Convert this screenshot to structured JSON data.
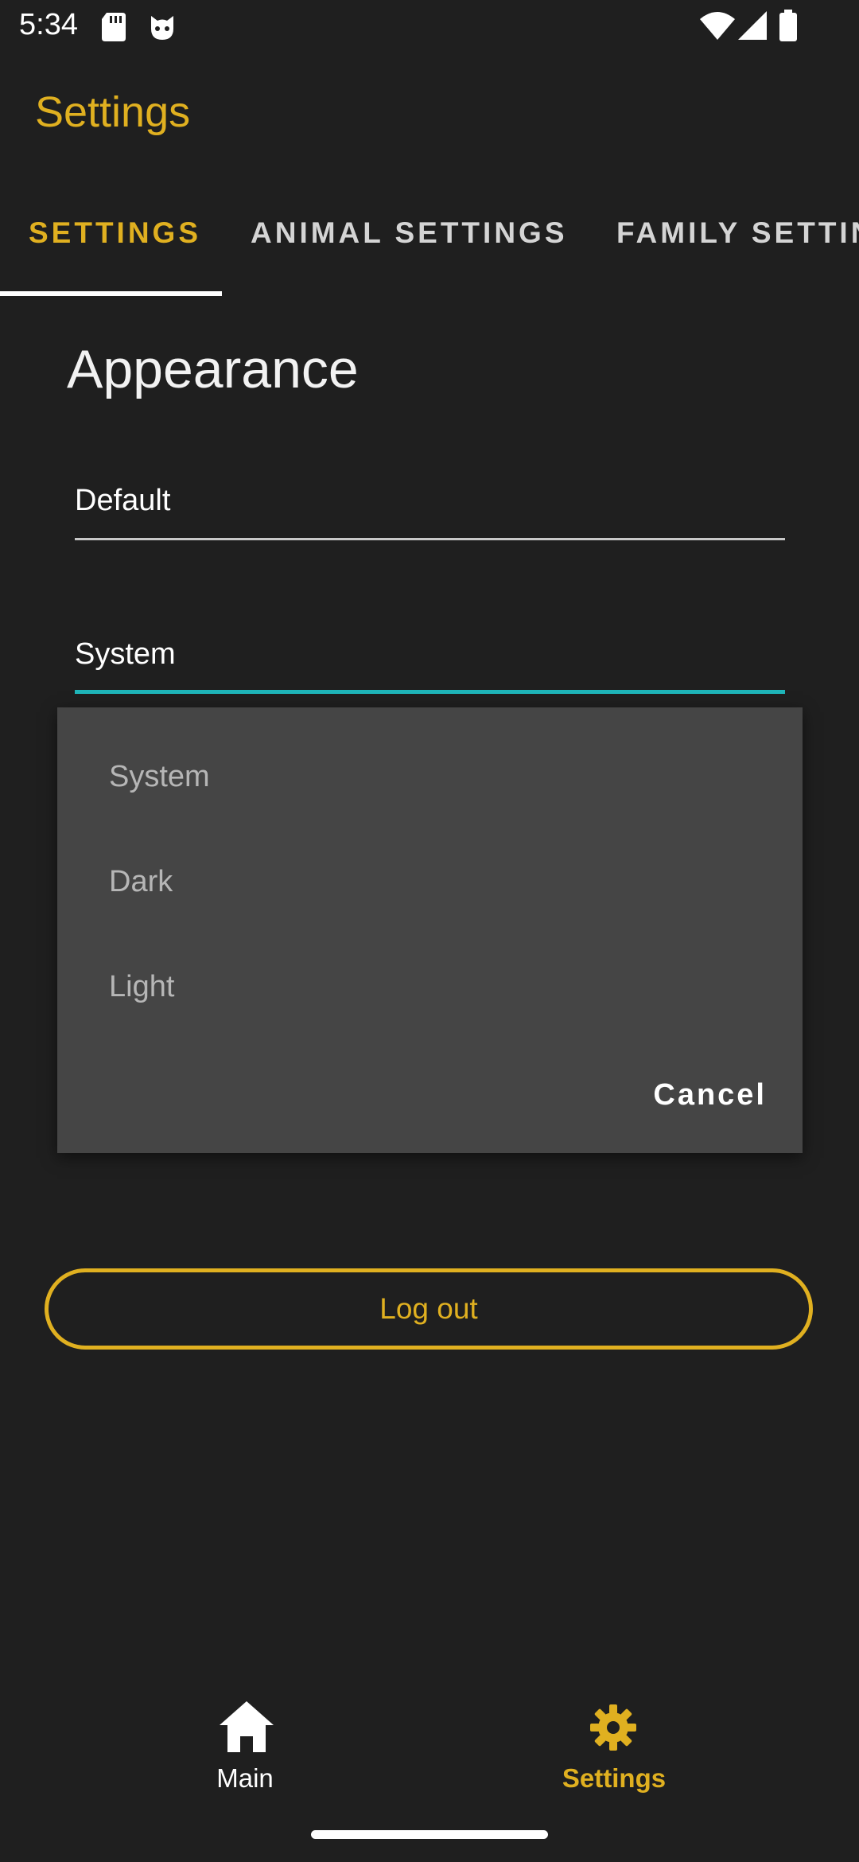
{
  "status_bar": {
    "time": "5:34",
    "icons": [
      "sd-card-icon",
      "cat-face-icon",
      "wifi-icon",
      "signal-icon",
      "battery-icon"
    ]
  },
  "app_bar": {
    "title": "Settings"
  },
  "tabs": [
    {
      "label": "SETTINGS",
      "selected": true
    },
    {
      "label": "ANIMAL SETTINGS",
      "selected": false
    },
    {
      "label": "FAMILY SETTIN",
      "selected": false
    }
  ],
  "section": {
    "title": "Appearance"
  },
  "fields": {
    "theme_value": "Default",
    "mode_value": "System"
  },
  "dropdown": {
    "options": [
      "System",
      "Dark",
      "Light"
    ],
    "cancel_label": "Cancel"
  },
  "logout_label": "Log out",
  "bottom_nav": [
    {
      "label": "Main",
      "icon": "home-icon",
      "selected": false
    },
    {
      "label": "Settings",
      "icon": "gear-icon",
      "selected": true
    }
  ],
  "colors": {
    "background": "#1f1f1f",
    "accent": "#e0b020",
    "focus_underline": "#1fb5b9",
    "dialog": "#454545"
  }
}
